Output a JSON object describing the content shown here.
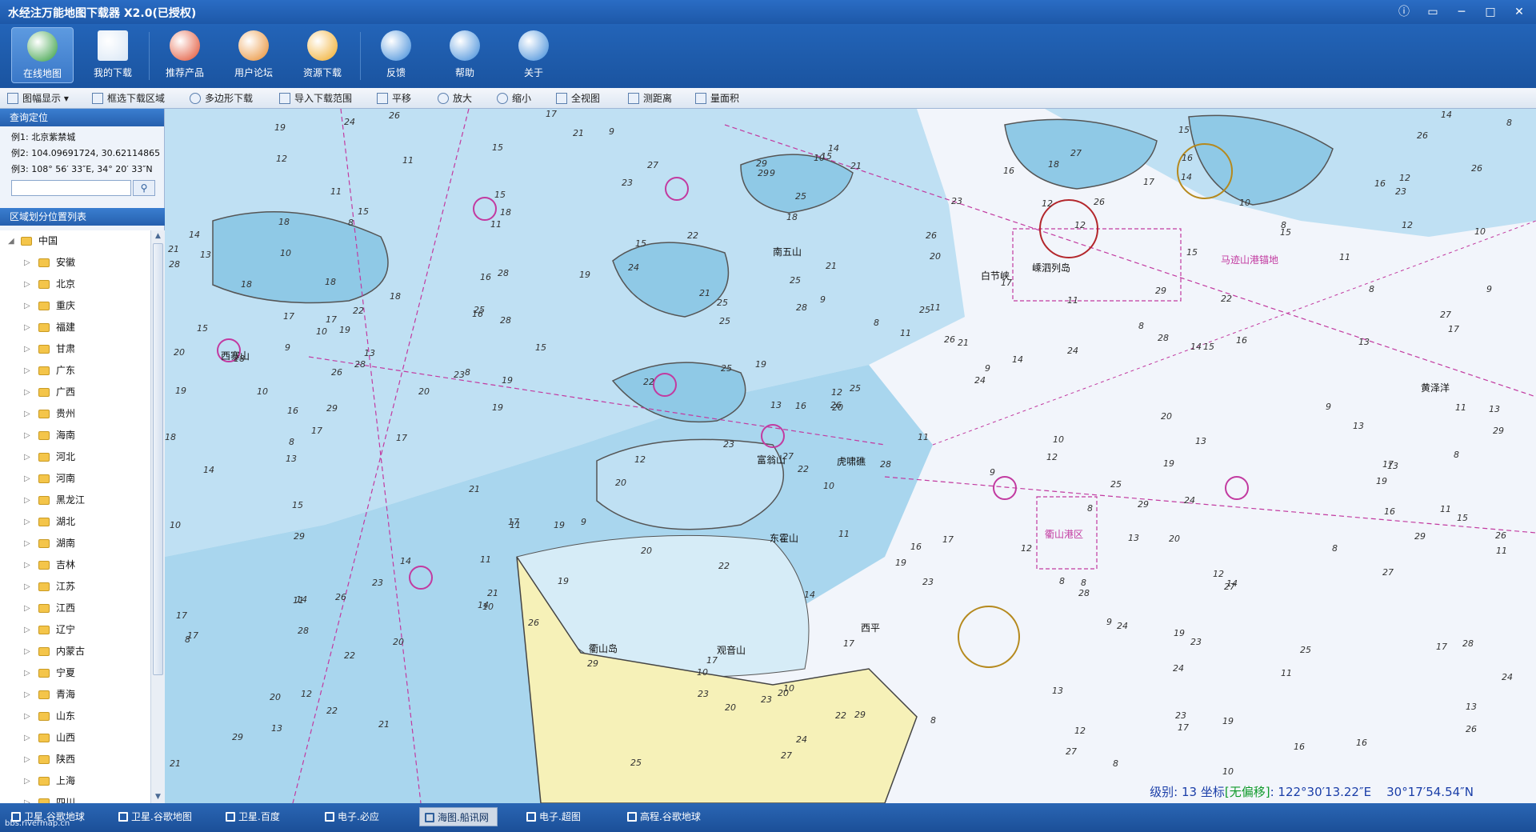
{
  "window": {
    "title": "水经注万能地图下载器 X2.0(已授权)"
  },
  "ribbon": [
    {
      "label": "在线地图",
      "color": "#2e9b3a"
    },
    {
      "label": "我的下载",
      "color": "#d8e6f5"
    },
    {
      "label": "推荐产品",
      "color": "#e04a2a"
    },
    {
      "label": "用户论坛",
      "color": "#e88a2a"
    },
    {
      "label": "资源下载",
      "color": "#f0a820"
    },
    {
      "label": "反馈",
      "color": "#3a88d8"
    },
    {
      "label": "帮助",
      "color": "#3a88d8"
    },
    {
      "label": "关于",
      "color": "#3a88d8"
    }
  ],
  "toolbar": [
    "图幅显示",
    "框选下载区域",
    "多边形下载",
    "导入下载范围",
    "平移",
    "放大",
    "缩小",
    "全视图",
    "测距离",
    "量面积"
  ],
  "left": {
    "query_title": "查询定位",
    "example1": "例1: 北京紫禁城",
    "example2": "例2: 104.09691724, 30.62114865",
    "example3": "例3: 108° 56′ 33″E, 34° 20′ 33″N",
    "search_placeholder": "",
    "region_title": "区域划分位置列表",
    "root": "中国",
    "provinces": [
      "安徽",
      "北京",
      "重庆",
      "福建",
      "甘肃",
      "广东",
      "广西",
      "贵州",
      "海南",
      "河北",
      "河南",
      "黑龙江",
      "湖北",
      "湖南",
      "吉林",
      "江苏",
      "江西",
      "辽宁",
      "内蒙古",
      "宁夏",
      "青海",
      "山东",
      "山西",
      "陕西",
      "上海",
      "四川"
    ]
  },
  "map": {
    "labels": [
      "嵊泗列岛",
      "马迹山港锚地",
      "衢山岛",
      "白节峡",
      "黄泽洋",
      "衢山港区",
      "虎啸礁",
      "东霍山",
      "南五山",
      "西寨山",
      "富翁山",
      "观音山",
      "西平"
    ],
    "status": {
      "level_label": "级别:",
      "level": "13",
      "coord_label": "坐标",
      "tag": "[无偏移]",
      "lon": "122°30′13.22″E",
      "lat": "30°17′54.54″N"
    }
  },
  "tabs": [
    "卫星.谷歌地球",
    "卫星.谷歌地图",
    "卫星.百度",
    "电子.必应",
    "海图.船讯网",
    "电子.超图",
    "高程.谷歌地球"
  ],
  "active_tab": "海图.船讯网",
  "watermark": "bbs.rivermap.cn"
}
